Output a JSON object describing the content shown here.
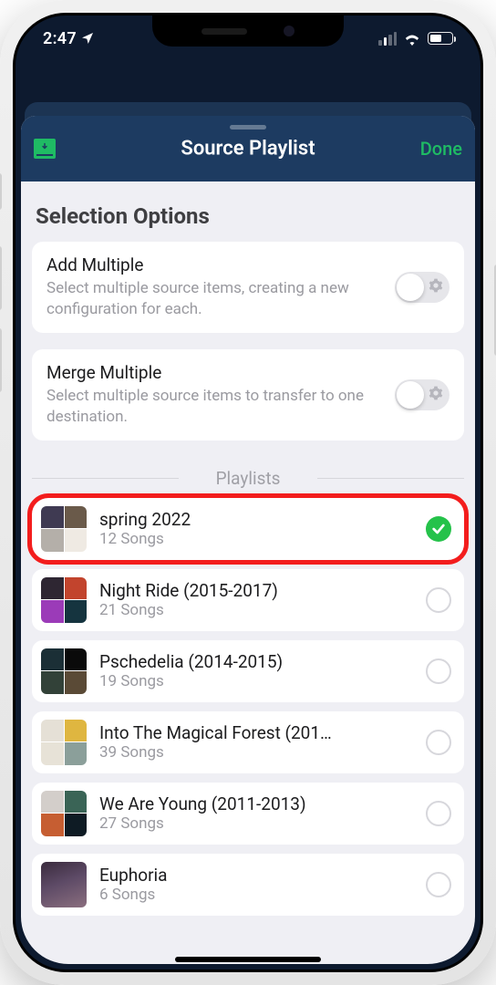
{
  "status": {
    "time": "2:47"
  },
  "nav": {
    "title": "Source Playlist",
    "done": "Done"
  },
  "section": {
    "heading": "Selection Options"
  },
  "options": {
    "addMultiple": {
      "title": "Add Multiple",
      "subtitle": "Select multiple source items, creating a new configuration for each."
    },
    "mergeMultiple": {
      "title": "Merge Multiple",
      "subtitle": "Select multiple source items to transfer to one destination."
    }
  },
  "playlistsHeader": "Playlists",
  "playlists": [
    {
      "title": "spring 2022",
      "subtitle": "12 Songs",
      "selected": true
    },
    {
      "title": "Night Ride (2015-2017)",
      "subtitle": "21 Songs",
      "selected": false
    },
    {
      "title": "Pschedelia (2014-2015)",
      "subtitle": "19 Songs",
      "selected": false
    },
    {
      "title": "Into The Magical Forest (201…",
      "subtitle": "39 Songs",
      "selected": false
    },
    {
      "title": "We Are Young (2011-2013)",
      "subtitle": "27 Songs",
      "selected": false
    },
    {
      "title": "Euphoria",
      "subtitle": "6 Songs",
      "selected": false
    }
  ]
}
